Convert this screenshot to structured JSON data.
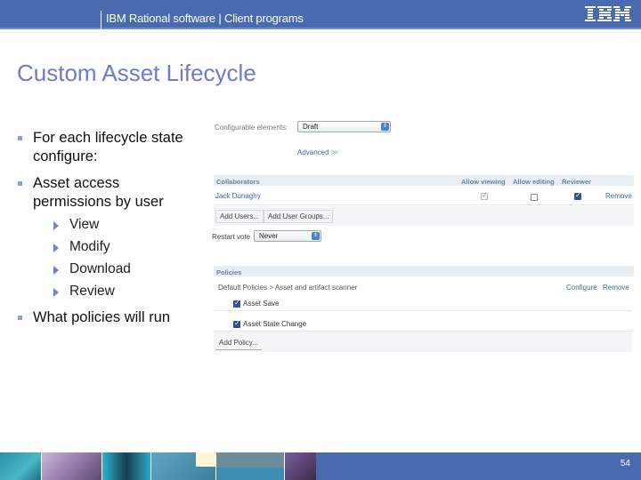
{
  "header": {
    "title": "IBM Rational software  |  Client programs",
    "logo": "IBM",
    "color": "#4a6aaf"
  },
  "slide": {
    "title": "Custom Asset Lifecycle",
    "title_color": "#6f79d0",
    "bullets": [
      {
        "text": "For each lifecycle state configure:"
      },
      {
        "text": "Asset access permissions by user",
        "sub": [
          "View",
          "Modify",
          "Download",
          "Review"
        ]
      },
      {
        "text": "What policies will run"
      }
    ],
    "page_number": "54"
  },
  "screenshot": {
    "configurable_label": "Configurable elements:",
    "configurable_value": "Draft",
    "advanced_link": "Advanced",
    "advanced_icon": "double-chevron-down",
    "collaborators": {
      "heading": "Collaborators",
      "columns": [
        "Allow viewing",
        "Allow editing",
        "Reviewer"
      ],
      "rows": [
        {
          "name": "Jack Donaghy",
          "allow_viewing": true,
          "allow_editing": false,
          "reviewer": true,
          "action": "Remove"
        }
      ],
      "add_users": "Add Users...",
      "add_user_groups": "Add User Groups..."
    },
    "restart_vote_label": "Restart vote",
    "restart_vote_value": "Never",
    "policies": {
      "heading": "Policies",
      "group": "Default Policies > Asset and artifact scanner",
      "configure": "Configure",
      "remove": "Remove",
      "items": [
        {
          "label": "Asset Save",
          "checked": true
        },
        {
          "label": "Asset State Change",
          "checked": true
        }
      ],
      "add_policy": "Add Policy..."
    }
  }
}
